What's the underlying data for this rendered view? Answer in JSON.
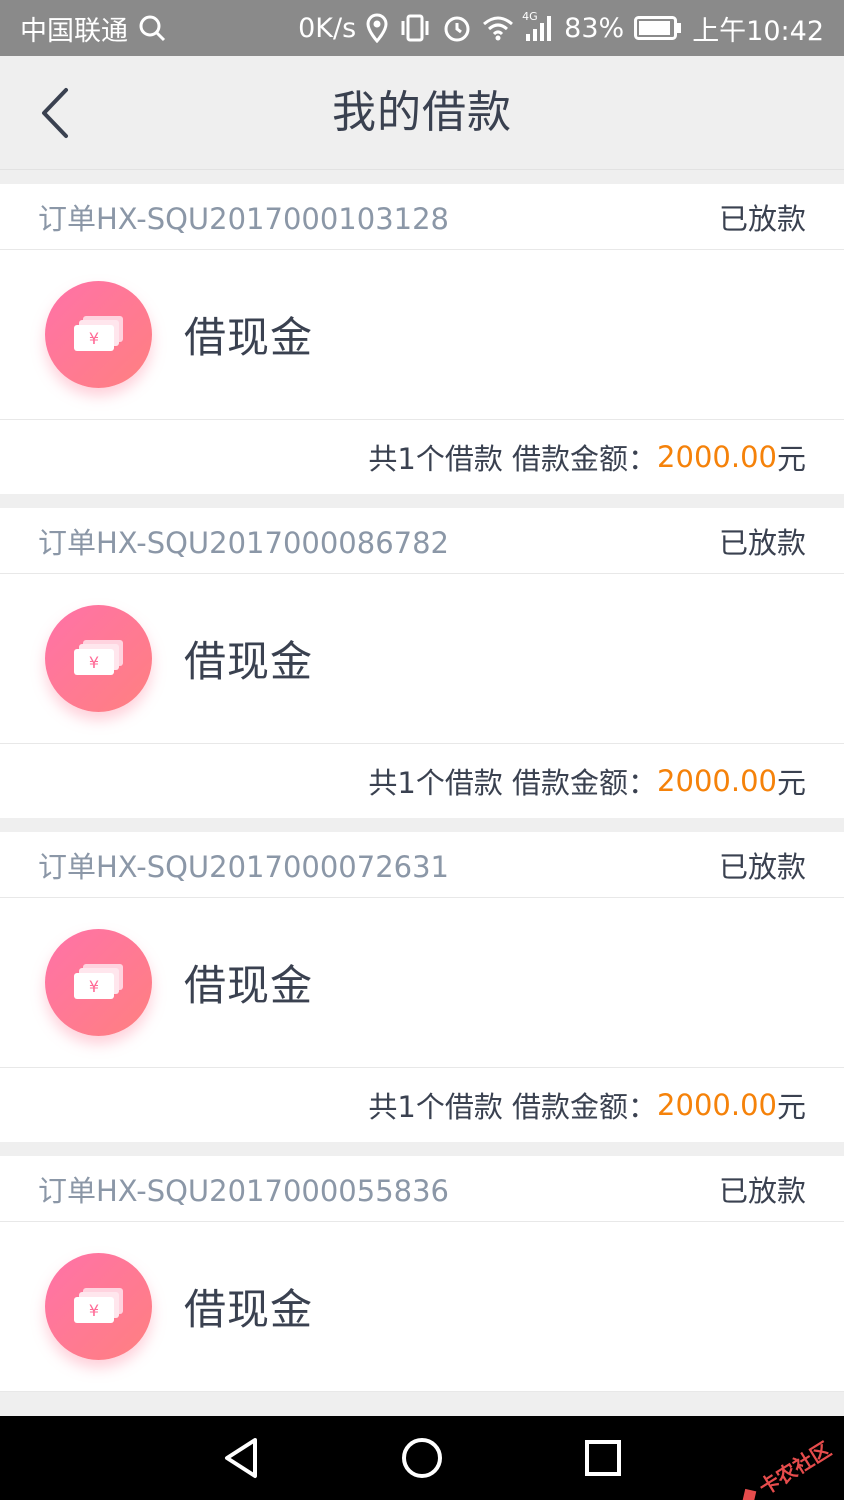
{
  "status_bar": {
    "carrier": "中国联通",
    "speed": "0K/s",
    "network": "4G",
    "battery": "83%",
    "time": "上午10:42"
  },
  "header": {
    "title": "我的借款"
  },
  "orders": [
    {
      "id": "订单HX-SQU2017000103128",
      "status": "已放款",
      "product": "借现金",
      "icon_symbol": "¥",
      "summary": "共1个借款 借款金额：",
      "amount": "2000.00",
      "unit": "元"
    },
    {
      "id": "订单HX-SQU2017000086782",
      "status": "已放款",
      "product": "借现金",
      "icon_symbol": "¥",
      "summary": "共1个借款 借款金额：",
      "amount": "2000.00",
      "unit": "元"
    },
    {
      "id": "订单HX-SQU2017000072631",
      "status": "已放款",
      "product": "借现金",
      "icon_symbol": "¥",
      "summary": "共1个借款 借款金额：",
      "amount": "2000.00",
      "unit": "元"
    },
    {
      "id": "订单HX-SQU2017000055836",
      "status": "已放款",
      "product": "借现金",
      "icon_symbol": "¥"
    }
  ],
  "watermark": {
    "text": "卡农社区"
  },
  "colors": {
    "amount": "#f5820a",
    "icon_gradient_start": "#ff72a8",
    "icon_gradient_end": "#ff8080",
    "status_bar": "#8a8a8a"
  },
  "icons": {
    "back": "chevron-left-icon",
    "search": "search-icon",
    "location": "location-icon",
    "vibrate": "vibrate-icon",
    "alarm": "alarm-icon",
    "wifi": "wifi-icon",
    "signal": "signal-icon",
    "battery": "battery-icon",
    "nav_back": "triangle-back-icon",
    "nav_home": "circle-home-icon",
    "nav_recent": "square-recent-icon"
  }
}
